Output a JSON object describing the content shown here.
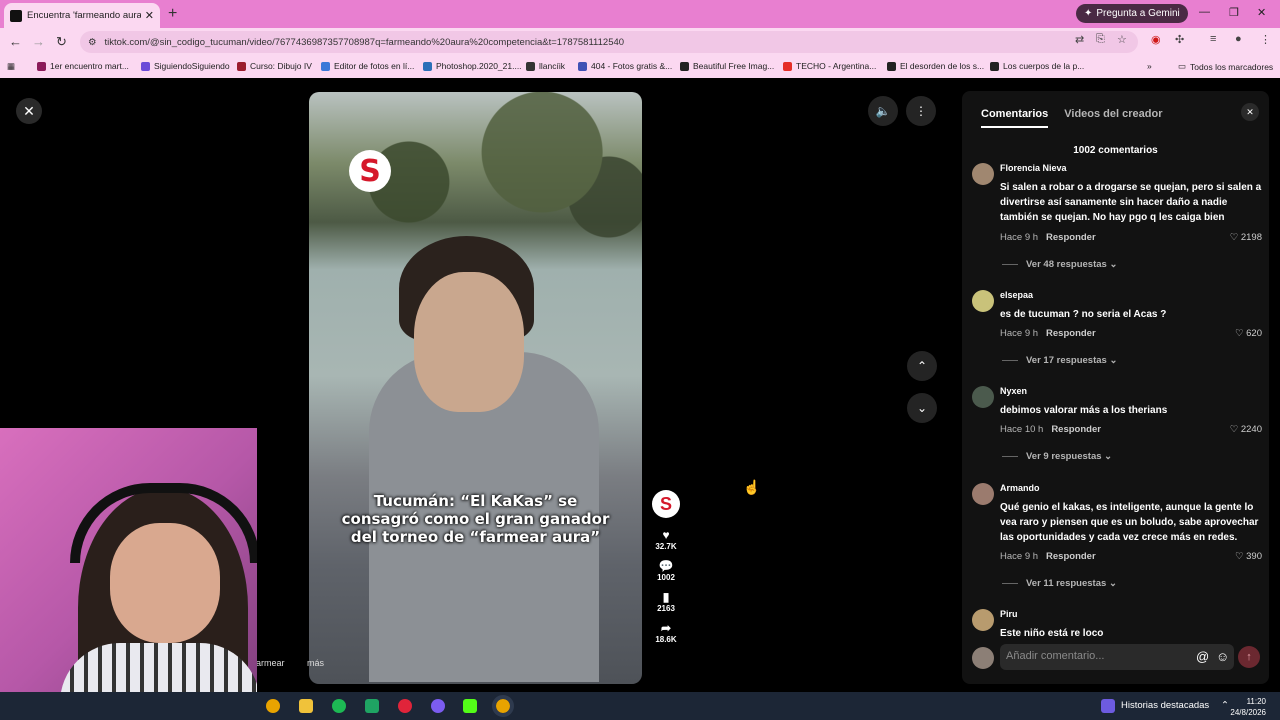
{
  "browser": {
    "tab_title": "Encuentra 'farmeando aura con",
    "tab_close": "✕",
    "new_tab": "+",
    "gemini_label": "Pregunta a Gemini",
    "url": "tiktok.com/@sin_codigo_tucuman/video/7677436987357708987q=farmeando%20aura%20competencia&t=1787581112540",
    "bookmarks": [
      {
        "label": "1er encuentro mart...",
        "color": "#8b1a5a"
      },
      {
        "label": "SiguiendoSiguiendo",
        "color": "#6b4bd8"
      },
      {
        "label": "Curso: Dibujo IV",
        "color": "#9b1c2e"
      },
      {
        "label": "Editor de fotos en lí...",
        "color": "#3b78d8"
      },
      {
        "label": "Photoshop.2020_21....",
        "color": "#2b6fb8"
      },
      {
        "label": "llancíik",
        "color": "#333333"
      },
      {
        "label": "404 - Fotos gratis &...",
        "color": "#3f51b5"
      },
      {
        "label": "Beautiful Free Imag...",
        "color": "#222222"
      },
      {
        "label": "TECHO - Argentina...",
        "color": "#e52d27"
      },
      {
        "label": "El desorden de los s...",
        "color": "#222222"
      },
      {
        "label": "Los cuerpos de la p...",
        "color": "#222222"
      }
    ],
    "all_bookmarks": "Todos los marcadores"
  },
  "video": {
    "logo_letter": "S",
    "caption": "Tucumán: “El KaKas” se consagró como el gran ganador del torneo de “farmear aura”",
    "likes": "32.7K",
    "comments": "1002",
    "saves": "2163",
    "shares": "18.6K",
    "tag_left": "armear",
    "tag_more": "más"
  },
  "panel": {
    "tab_comments": "Comentarios",
    "tab_creator": "Videos del creador",
    "count": "1002 comentarios",
    "reply_label": "Responder",
    "comments": [
      {
        "user": "Florencia Nieva",
        "text": "Si salen a robar o a drogarse se quejan, pero si salen a divertirse así sanamente sin hacer daño a nadie también se quejan. No hay pgo q les caiga bien",
        "time": "Hace 9 h",
        "likes": "2198",
        "replies": "Ver 48 respuestas",
        "avatar": "#a08770"
      },
      {
        "user": "elsepaa",
        "text": "es de tucuman ? no seria el Acas ?",
        "time": "Hace 9 h",
        "likes": "620",
        "replies": "Ver 17 respuestas",
        "avatar": "#c9c27a"
      },
      {
        "user": "Nyxen",
        "text": "debimos valorar más a los therians",
        "time": "Hace 10 h",
        "likes": "2240",
        "replies": "Ver 9 respuestas",
        "avatar": "#4b5a4d"
      },
      {
        "user": "Armando",
        "text": "Qué genio el kakas, es inteligente, aunque la gente lo vea raro y piensen que es un boludo, sabe aprovechar las oportunidades y cada vez crece más en redes.",
        "time": "Hace 9 h",
        "likes": "390",
        "replies": "Ver 11 respuestas",
        "avatar": "#9b7b6e"
      },
      {
        "user": "Piru",
        "text": "Este niño está re loco",
        "time": "",
        "likes": "",
        "replies": "",
        "avatar": "#b89b6e"
      }
    ],
    "input_placeholder": "Añadir comentario..."
  },
  "taskbar": {
    "highlights": "Historias destacadas",
    "time": "11:20",
    "date": "24/8/2026"
  }
}
